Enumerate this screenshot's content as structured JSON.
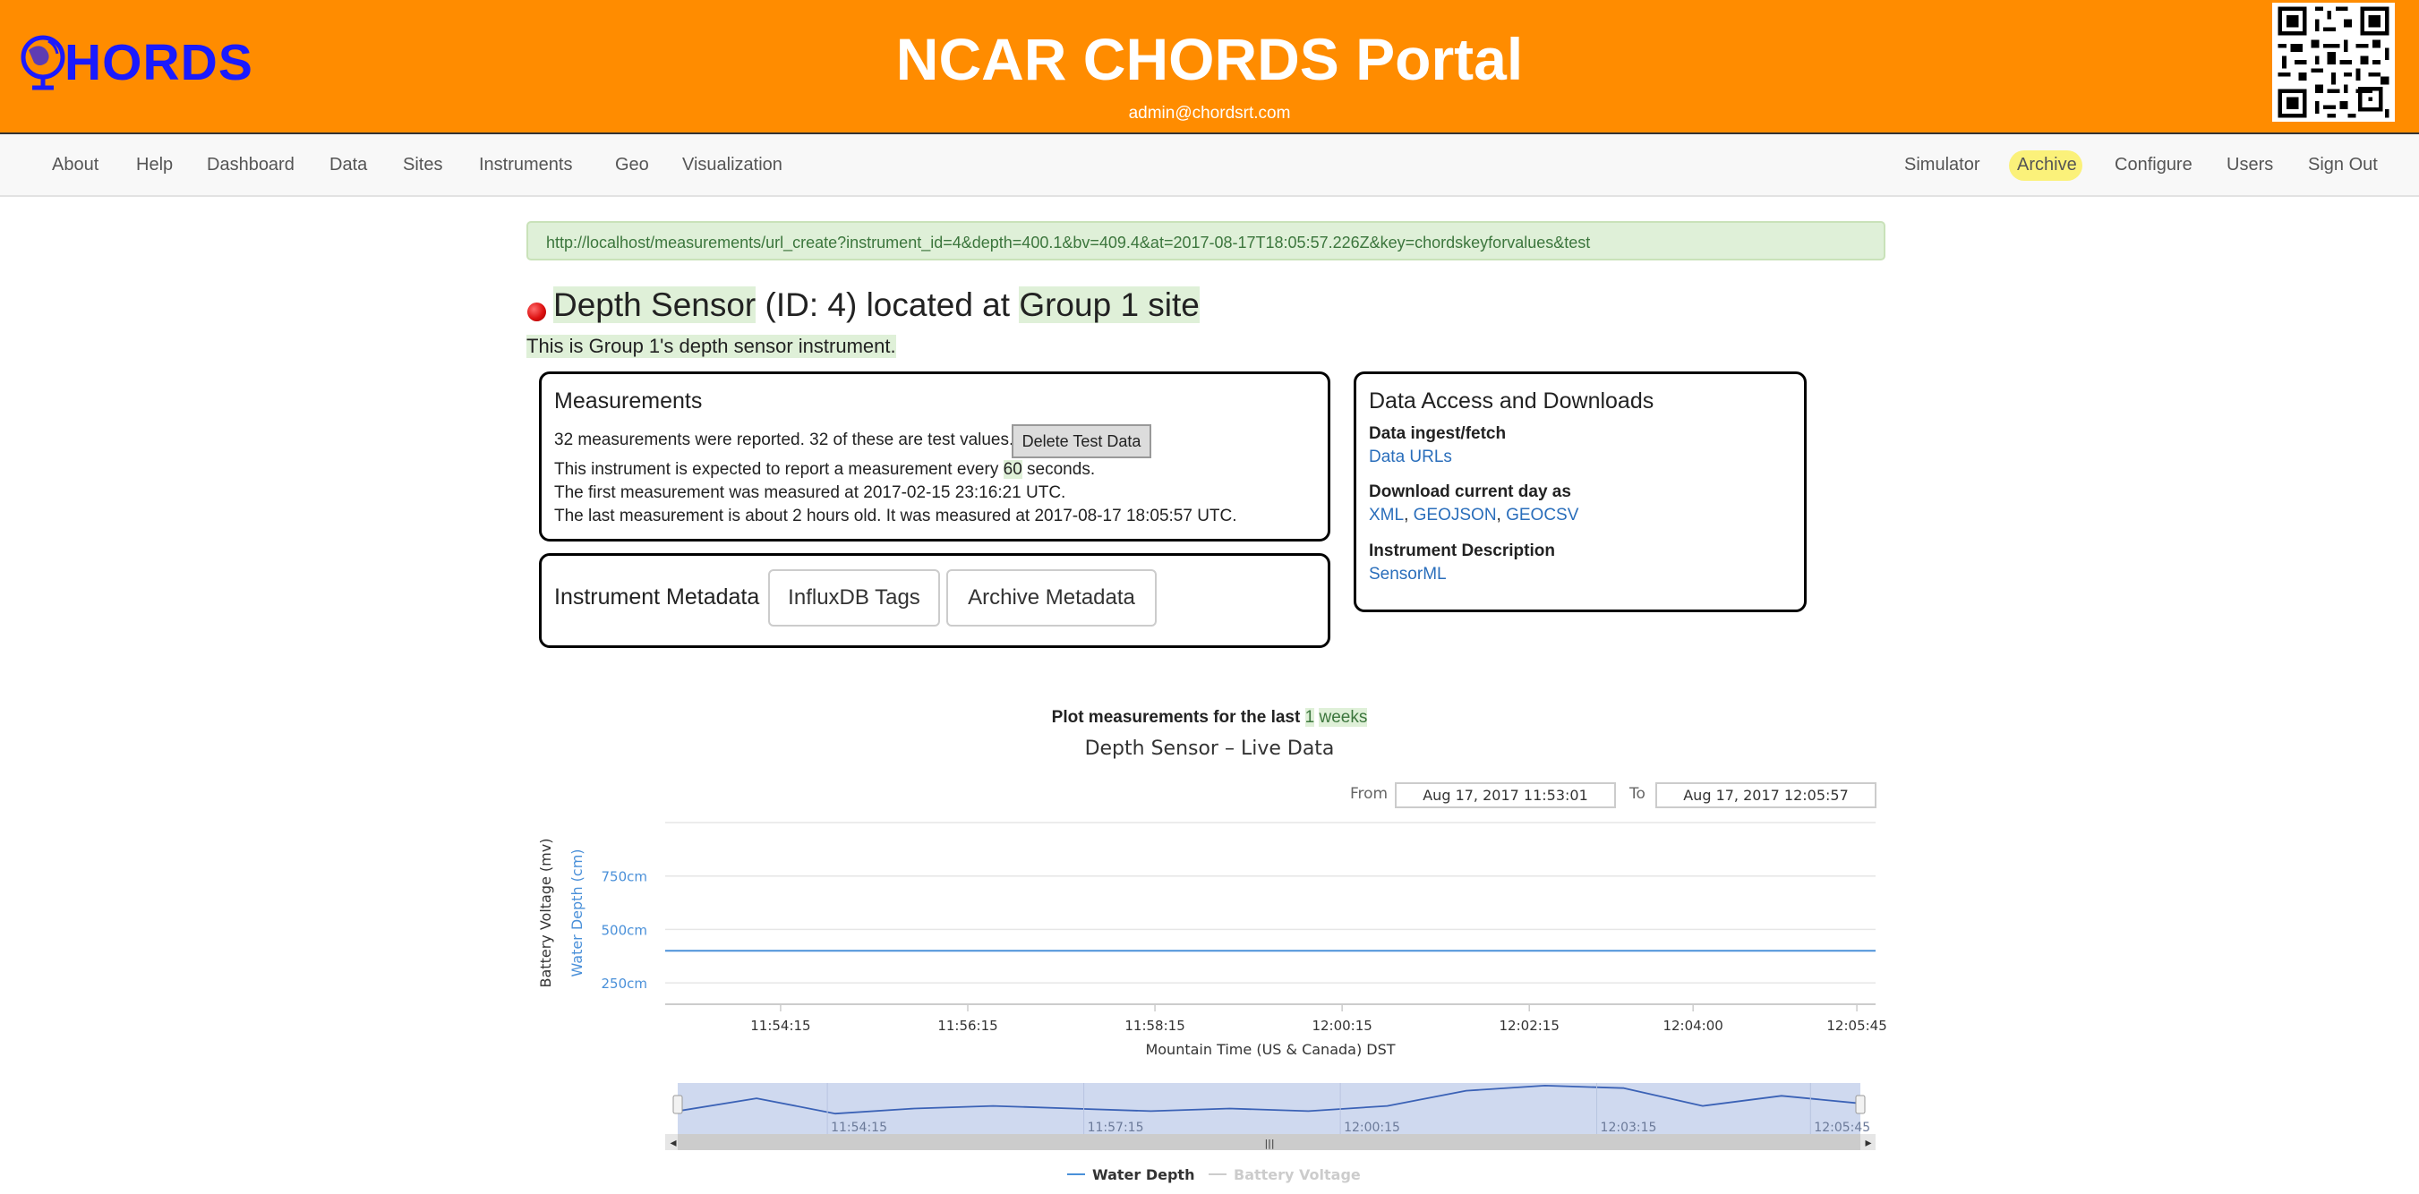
{
  "header": {
    "logo_text": "HORDS",
    "title": "NCAR CHORDS Portal",
    "user_email": "admin@chordsrt.com"
  },
  "nav": {
    "left": [
      "About",
      "Help",
      "Dashboard",
      "Data",
      "Sites",
      "Instruments",
      "Geo",
      "Visualization"
    ],
    "right": [
      "Simulator",
      "Archive",
      "Configure",
      "Users",
      "Sign Out"
    ]
  },
  "url_alert": "http://localhost/measurements/url_create?instrument_id=4&depth=400.1&bv=409.4&at=2017-08-17T18:05:57.226Z&key=chordskeyforvalues&test",
  "instrument": {
    "name": "Depth Sensor",
    "id_text": "(ID: 4) located at",
    "site": "Group 1 site",
    "description": "This is Group 1's depth sensor instrument."
  },
  "measurements": {
    "title": "Measurements",
    "reported": "32 measurements were reported. 32 of these are test values.",
    "delete_button": "Delete Test Data",
    "interval_prefix": "This instrument is expected to report a measurement every",
    "interval_value": "60",
    "interval_suffix": "seconds.",
    "first": "The first measurement was measured at 2017-02-15 23:16:21 UTC.",
    "last": "The last measurement is about 2 hours old. It was measured at 2017-08-17 18:05:57 UTC."
  },
  "metadata": {
    "title": "Instrument Metadata",
    "influx_button": "InfluxDB Tags",
    "archive_button": "Archive Metadata"
  },
  "downloads": {
    "title": "Data Access and Downloads",
    "ingest_heading": "Data ingest/fetch",
    "data_urls_link": "Data URLs",
    "download_heading": "Download current day as",
    "formats": [
      "XML",
      "GEOJSON",
      "GEOCSV"
    ],
    "description_heading": "Instrument Description",
    "sensorml_link": "SensorML"
  },
  "plot": {
    "caption_prefix": "Plot measurements for the last",
    "caption_value": "1",
    "caption_suffix": "weeks",
    "from_label": "From",
    "from_value": "Aug 17, 2017 11:53:01",
    "to_label": "To",
    "to_value": "Aug 17, 2017 12:05:57"
  },
  "colors": {
    "header_bg": "#ff8c00",
    "water_depth": "#4a90d9",
    "battery_voltage": "#cccccc",
    "highlight_green": "#dff0d8"
  },
  "chart_data": {
    "type": "line",
    "title": "Depth Sensor – Live Data",
    "xlabel": "Mountain Time (US & Canada) DST",
    "ylabels": [
      "Battery Voltage (mv)",
      "Water Depth (cm)"
    ],
    "x_ticks": [
      "11:54:15",
      "11:56:15",
      "11:58:15",
      "12:00:15",
      "12:02:15",
      "12:04:00",
      "12:05:45"
    ],
    "y_ticks": [
      "250cm",
      "500cm",
      "750cm"
    ],
    "ylim": [
      150,
      1000
    ],
    "grid": true,
    "series": [
      {
        "name": "Water Depth",
        "color": "#4a90d9",
        "x": [
          "11:53:01",
          "11:54:15",
          "11:56:15",
          "11:58:15",
          "12:00:15",
          "12:02:15",
          "12:04:00",
          "12:05:57"
        ],
        "values": [
          400,
          400,
          400,
          400,
          400,
          400,
          400,
          400
        ]
      },
      {
        "name": "Battery Voltage",
        "color": "#cccccc",
        "visible": false,
        "values": []
      }
    ],
    "navigator_ticks": [
      "11:54:15",
      "11:57:15",
      "12:00:15",
      "12:03:15",
      "12:05:45"
    ],
    "navigator_profile": [
      0.45,
      0.7,
      0.4,
      0.5,
      0.55,
      0.5,
      0.45,
      0.5,
      0.45,
      0.55,
      0.85,
      0.95,
      0.9,
      0.55,
      0.75,
      0.6
    ],
    "legend": [
      "Water Depth",
      "Battery Voltage"
    ],
    "legend_position": "bottom-center"
  }
}
